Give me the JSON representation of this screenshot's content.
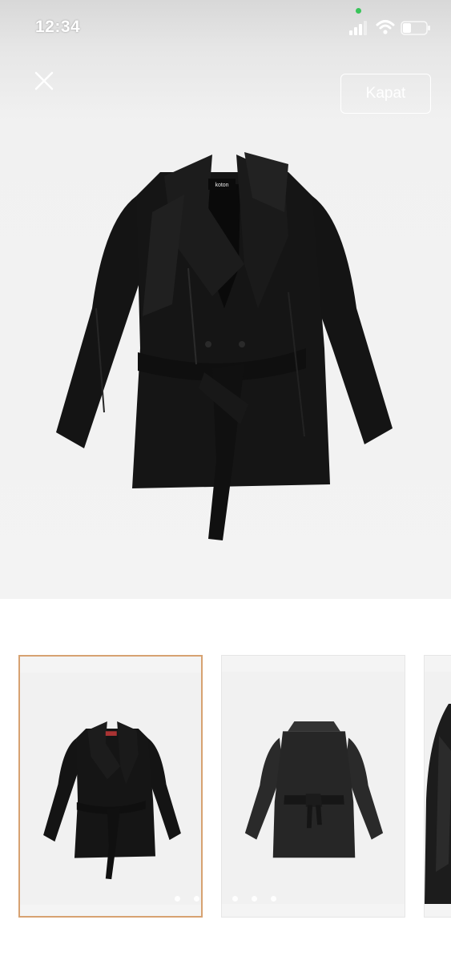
{
  "status_bar": {
    "time": "12:34"
  },
  "header": {
    "close_button": "close-icon",
    "dismiss_label": "Kapat"
  },
  "main_image": {
    "brand_label": "koton",
    "alt": "jacket-front"
  },
  "thumbnails": [
    {
      "brand_label": "koton",
      "selected": true
    },
    {
      "selected": false
    },
    {
      "selected": false
    }
  ],
  "colors": {
    "active_border": "#d7a271",
    "jacket": "#121212",
    "background": "#f3f3f3"
  }
}
